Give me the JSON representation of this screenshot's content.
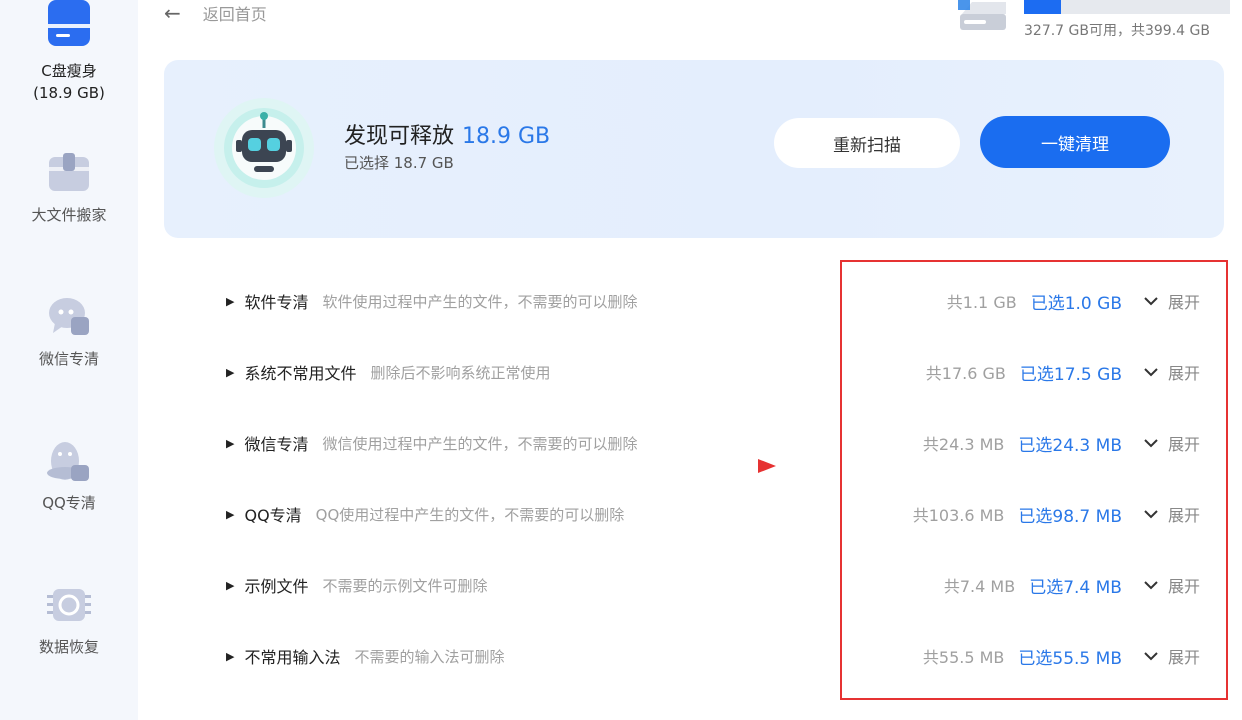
{
  "sidebar": {
    "items": [
      {
        "label": "C盘瘦身",
        "sub": "(18.9 GB)",
        "icon": "drive-icon"
      },
      {
        "label": "大文件搬家",
        "icon": "box-icon"
      },
      {
        "label": "微信专清",
        "icon": "chat-icon"
      },
      {
        "label": "QQ专清",
        "icon": "penguin-icon"
      },
      {
        "label": "数据恢复",
        "icon": "chip-icon"
      }
    ]
  },
  "header": {
    "back_label": "返回首页",
    "disk_usage_text": "327.7 GB可用，共399.4 GB",
    "disk_used_fraction": 0.18
  },
  "banner": {
    "title_prefix": "发现可释放",
    "title_size": "18.9 GB",
    "subtitle": "已选择 18.7 GB",
    "rescan_label": "重新扫描",
    "clean_label": "一键清理"
  },
  "categories": [
    {
      "name": "软件专清",
      "desc": "软件使用过程中产生的文件，不需要的可以删除",
      "total": "共1.1 GB",
      "selected": "已选1.0 GB",
      "expand": "展开"
    },
    {
      "name": "系统不常用文件",
      "desc": "删除后不影响系统正常使用",
      "total": "共17.6 GB",
      "selected": "已选17.5 GB",
      "expand": "展开"
    },
    {
      "name": "微信专清",
      "desc": "微信使用过程中产生的文件，不需要的可以删除",
      "total": "共24.3 MB",
      "selected": "已选24.3 MB",
      "expand": "展开"
    },
    {
      "name": "QQ专清",
      "desc": "QQ使用过程中产生的文件，不需要的可以删除",
      "total": "共103.6 MB",
      "selected": "已选98.7 MB",
      "expand": "展开"
    },
    {
      "name": "示例文件",
      "desc": "不需要的示例文件可删除",
      "total": "共7.4 MB",
      "selected": "已选7.4 MB",
      "expand": "展开"
    },
    {
      "name": "不常用输入法",
      "desc": "不需要的输入法可删除",
      "total": "共55.5 MB",
      "selected": "已选55.5 MB",
      "expand": "展开"
    }
  ],
  "colors": {
    "accent": "#1a6df0",
    "annotation": "#e63232"
  }
}
